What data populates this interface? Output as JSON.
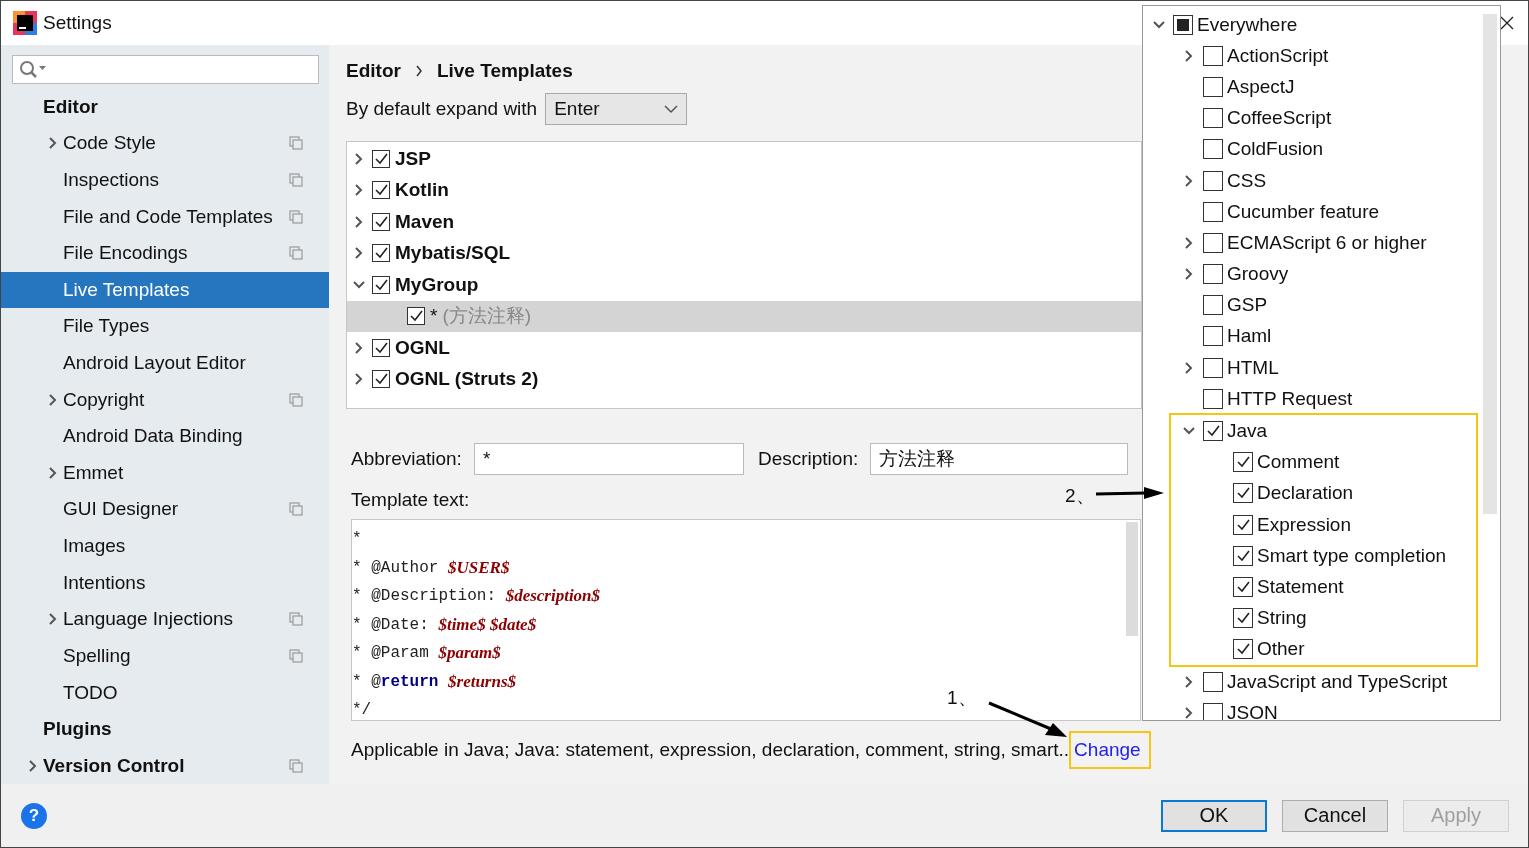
{
  "window": {
    "title": "Settings"
  },
  "sidebar": {
    "items": [
      {
        "label": "Editor",
        "collapsed": false,
        "shared": false,
        "selected": false,
        "children": [
          {
            "label": "Code Style",
            "collapsed": true,
            "shared": true,
            "selected": false
          },
          {
            "label": "Inspections",
            "collapsed": false,
            "shared": true,
            "selected": false
          },
          {
            "label": "File and Code Templates",
            "collapsed": false,
            "shared": true,
            "selected": false
          },
          {
            "label": "File Encodings",
            "collapsed": false,
            "shared": true,
            "selected": false
          },
          {
            "label": "Live Templates",
            "collapsed": false,
            "shared": false,
            "selected": true
          },
          {
            "label": "File Types",
            "collapsed": false,
            "shared": false,
            "selected": false
          },
          {
            "label": "Android Layout Editor",
            "collapsed": false,
            "shared": false,
            "selected": false
          },
          {
            "label": "Copyright",
            "collapsed": true,
            "shared": true,
            "selected": false
          },
          {
            "label": "Android Data Binding",
            "collapsed": false,
            "shared": false,
            "selected": false
          },
          {
            "label": "Emmet",
            "collapsed": true,
            "shared": false,
            "selected": false
          },
          {
            "label": "GUI Designer",
            "collapsed": false,
            "shared": true,
            "selected": false
          },
          {
            "label": "Images",
            "collapsed": false,
            "shared": false,
            "selected": false
          },
          {
            "label": "Intentions",
            "collapsed": false,
            "shared": false,
            "selected": false
          },
          {
            "label": "Language Injections",
            "collapsed": true,
            "shared": true,
            "selected": false
          },
          {
            "label": "Spelling",
            "collapsed": false,
            "shared": true,
            "selected": false
          },
          {
            "label": "TODO",
            "collapsed": false,
            "shared": false,
            "selected": false
          }
        ]
      },
      {
        "label": "Plugins",
        "collapsed": false,
        "shared": false,
        "selected": false
      },
      {
        "label": "Version Control",
        "collapsed": true,
        "shared": true,
        "selected": false
      }
    ]
  },
  "main": {
    "breadcrumb": [
      "Editor",
      "Live Templates"
    ],
    "expand_with": {
      "label": "By default expand with",
      "value": "Enter"
    },
    "templates": [
      {
        "label": "JSP",
        "checked": true,
        "expanded": false
      },
      {
        "label": "Kotlin",
        "checked": true,
        "expanded": false
      },
      {
        "label": "Maven",
        "checked": true,
        "expanded": false
      },
      {
        "label": "Mybatis/SQL",
        "checked": true,
        "expanded": false
      },
      {
        "label": "MyGroup",
        "checked": true,
        "expanded": true,
        "children": [
          {
            "abbreviation": "*",
            "description": "(方法注释)",
            "checked": true,
            "selected": true
          }
        ]
      },
      {
        "label": "OGNL",
        "checked": true,
        "expanded": false
      },
      {
        "label": "OGNL (Struts 2)",
        "checked": true,
        "expanded": false
      }
    ],
    "abbreviation": {
      "label": "Abbreviation:",
      "value": "*"
    },
    "description": {
      "label": "Description:",
      "value": "方法注释"
    },
    "template_text": {
      "label": "Template text:",
      "lines": [
        [
          {
            "kind": "text",
            "text": "*"
          }
        ],
        [
          {
            "kind": "text",
            "text": "* @Author "
          },
          {
            "kind": "var",
            "text": "$USER$"
          }
        ],
        [
          {
            "kind": "text",
            "text": "* @Description: "
          },
          {
            "kind": "var",
            "text": "$description$"
          }
        ],
        [
          {
            "kind": "text",
            "text": "* @Date: "
          },
          {
            "kind": "var",
            "text": "$time$ $date$"
          }
        ],
        [
          {
            "kind": "text",
            "text": "* @Param "
          },
          {
            "kind": "var",
            "text": "$param$"
          }
        ],
        [
          {
            "kind": "text",
            "text": "* @"
          },
          {
            "kind": "keyword",
            "text": "return"
          },
          {
            "kind": "var",
            "text": "$returns$"
          }
        ],
        [
          {
            "kind": "text",
            "text": "*/"
          }
        ]
      ]
    },
    "context": {
      "text": "Applicable in Java; Java: statement, expression, declaration, comment, string, smart..",
      "link": "Change",
      "highlighted": true
    }
  },
  "popup": {
    "items": [
      {
        "label": "Everywhere",
        "checked": false,
        "partial": true,
        "has_children": true,
        "expanded": true,
        "highlighted": false,
        "children": [
          {
            "label": "ActionScript",
            "checked": false,
            "partial": false,
            "has_children": true,
            "expanded": false,
            "highlighted": false
          },
          {
            "label": "AspectJ",
            "checked": false,
            "partial": false,
            "has_children": false,
            "highlighted": false
          },
          {
            "label": "CoffeeScript",
            "checked": false,
            "partial": false,
            "has_children": false,
            "highlighted": false
          },
          {
            "label": "ColdFusion",
            "checked": false,
            "partial": false,
            "has_children": false,
            "highlighted": false
          },
          {
            "label": "CSS",
            "checked": false,
            "partial": false,
            "has_children": true,
            "expanded": false,
            "highlighted": false
          },
          {
            "label": "Cucumber feature",
            "checked": false,
            "partial": false,
            "has_children": false,
            "highlighted": false
          },
          {
            "label": "ECMAScript 6 or higher",
            "checked": false,
            "partial": false,
            "has_children": true,
            "expanded": false,
            "highlighted": false
          },
          {
            "label": "Groovy",
            "checked": false,
            "partial": false,
            "has_children": true,
            "expanded": false,
            "highlighted": false
          },
          {
            "label": "GSP",
            "checked": false,
            "partial": false,
            "has_children": false,
            "highlighted": false
          },
          {
            "label": "Haml",
            "checked": false,
            "partial": false,
            "has_children": false,
            "highlighted": false
          },
          {
            "label": "HTML",
            "checked": false,
            "partial": false,
            "has_children": true,
            "expanded": false,
            "highlighted": false
          },
          {
            "label": "HTTP Request",
            "checked": false,
            "partial": false,
            "has_children": false,
            "highlighted": false
          },
          {
            "label": "Java",
            "checked": true,
            "partial": false,
            "has_children": true,
            "expanded": true,
            "highlighted": true,
            "children": [
              {
                "label": "Comment",
                "checked": true,
                "partial": false,
                "has_children": false,
                "highlighted": false
              },
              {
                "label": "Declaration",
                "checked": true,
                "partial": false,
                "has_children": false,
                "highlighted": false
              },
              {
                "label": "Expression",
                "checked": true,
                "partial": false,
                "has_children": false,
                "highlighted": false
              },
              {
                "label": "Smart type completion",
                "checked": true,
                "partial": false,
                "has_children": false,
                "highlighted": false
              },
              {
                "label": "Statement",
                "checked": true,
                "partial": false,
                "has_children": false,
                "highlighted": false
              },
              {
                "label": "String",
                "checked": true,
                "partial": false,
                "has_children": false,
                "highlighted": false
              },
              {
                "label": "Other",
                "checked": true,
                "partial": false,
                "has_children": false,
                "highlighted": false
              }
            ]
          },
          {
            "label": "JavaScript and TypeScript",
            "checked": false,
            "partial": false,
            "has_children": true,
            "expanded": false,
            "highlighted": false
          },
          {
            "label": "JSON",
            "checked": false,
            "partial": false,
            "has_children": true,
            "expanded": false,
            "highlighted": false
          }
        ]
      }
    ]
  },
  "annotations": [
    {
      "label": "1、"
    },
    {
      "label": "2、"
    }
  ],
  "footer": {
    "help": "?",
    "buttons": [
      {
        "label": "OK",
        "default": true,
        "disabled": false
      },
      {
        "label": "Cancel",
        "default": false,
        "disabled": false
      },
      {
        "label": "Apply",
        "default": false,
        "disabled": true
      }
    ]
  }
}
